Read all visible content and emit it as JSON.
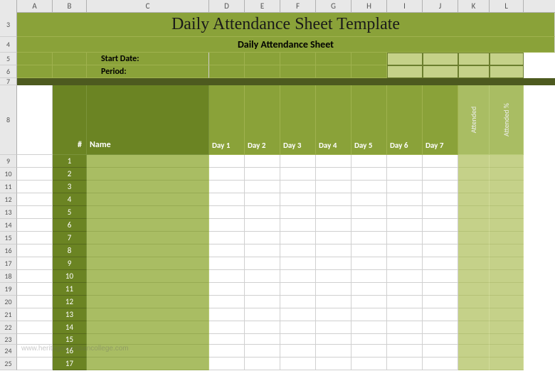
{
  "columns": [
    "A",
    "B",
    "C",
    "D",
    "E",
    "F",
    "G",
    "H",
    "I",
    "J",
    "K",
    "L"
  ],
  "col_widths": [
    "wA",
    "wB",
    "wC",
    "wD",
    "wE",
    "wF",
    "wG",
    "wH",
    "wI",
    "wJ",
    "wK",
    "wL"
  ],
  "row_nums": [
    3,
    4,
    5,
    6,
    7,
    8,
    9,
    10,
    11,
    12,
    13,
    14,
    15,
    16,
    17,
    18,
    19,
    20,
    21,
    22,
    23,
    24,
    25
  ],
  "title": "Daily Attendance Sheet Template",
  "subtitle": "Daily Attendance Sheet",
  "fields": {
    "start_date_label": "Start Date:",
    "period_label": "Period:",
    "start_date_value": "",
    "period_value": ""
  },
  "headers": {
    "num": "#",
    "name": "Name",
    "days": [
      "Day 1",
      "Day 2",
      "Day 3",
      "Day 4",
      "Day 5",
      "Day 6",
      "Day 7"
    ],
    "attended": "Attended",
    "attended_pct": "Attended %"
  },
  "rows": [
    {
      "n": 1
    },
    {
      "n": 2
    },
    {
      "n": 3
    },
    {
      "n": 4
    },
    {
      "n": 5
    },
    {
      "n": 6
    },
    {
      "n": 7
    },
    {
      "n": 8
    },
    {
      "n": 9
    },
    {
      "n": 10
    },
    {
      "n": 11
    },
    {
      "n": 12
    },
    {
      "n": 13
    },
    {
      "n": 14
    },
    {
      "n": 15
    },
    {
      "n": 16
    },
    {
      "n": 17
    }
  ],
  "watermark": "www.heritagechristiancollege.com",
  "chart_data": {
    "type": "table",
    "title": "Daily Attendance Sheet Template",
    "subtitle": "Daily Attendance Sheet",
    "fields": [
      {
        "label": "Start Date:",
        "value": ""
      },
      {
        "label": "Period:",
        "value": ""
      }
    ],
    "columns": [
      "#",
      "Name",
      "Day 1",
      "Day 2",
      "Day 3",
      "Day 4",
      "Day 5",
      "Day 6",
      "Day 7",
      "Attended",
      "Attended %"
    ],
    "rows_visible": 17,
    "rows_data": []
  }
}
